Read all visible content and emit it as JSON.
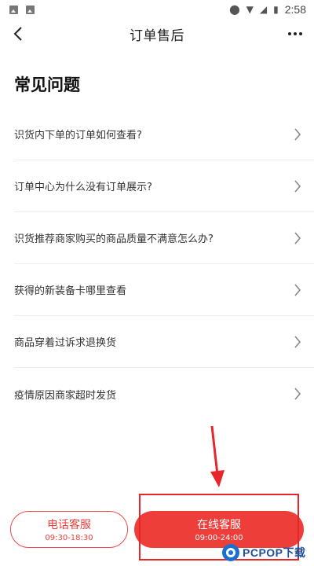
{
  "status_bar": {
    "time": "2:58",
    "icons": [
      "image-icon",
      "image-icon",
      "location-icon",
      "wifi-icon",
      "signal-icon",
      "battery-icon"
    ]
  },
  "nav": {
    "title": "订单售后",
    "back_icon": "chevron-left-icon",
    "more_icon": "more-dots-icon"
  },
  "faq": {
    "title": "常见问题",
    "items": [
      {
        "label": "识货内下单的订单如何查看?"
      },
      {
        "label": "订单中心为什么没有订单展示?"
      },
      {
        "label": "识货推荐商家购买的商品质量不满意怎么办?"
      },
      {
        "label": "获得的新装备卡哪里查看"
      },
      {
        "label": "商品穿着过诉求退换货"
      },
      {
        "label": "疫情原因商家超时发货"
      }
    ]
  },
  "bottom_actions": {
    "phone": {
      "label": "电话客服",
      "hours": "09:30-18:30"
    },
    "online": {
      "label": "在线客服",
      "hours": "09:00-24:00"
    }
  },
  "watermark": {
    "text": "PCPOP下载"
  },
  "colors": {
    "accent": "#ee3e3a",
    "annotation": "#e8262a",
    "watermark": "#1a4f9a"
  }
}
